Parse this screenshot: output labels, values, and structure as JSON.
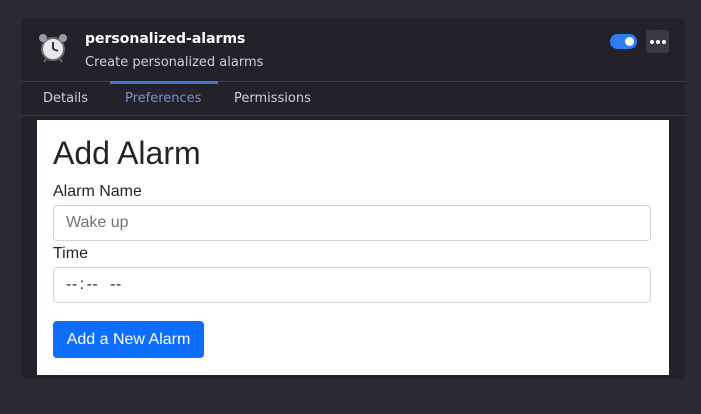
{
  "addon": {
    "name": "personalized-alarms",
    "description": "Create personalized alarms",
    "icon": "alarm-clock-icon",
    "enabled": true
  },
  "tabs": [
    {
      "label": "Details",
      "active": false
    },
    {
      "label": "Preferences",
      "active": true
    },
    {
      "label": "Permissions",
      "active": false
    }
  ],
  "form": {
    "title": "Add Alarm",
    "alarm_name_label": "Alarm Name",
    "alarm_name_placeholder": "Wake up",
    "time_label": "Time",
    "time_hours": "--",
    "time_minutes": "--",
    "time_period": "--",
    "submit_label": "Add a New Alarm"
  },
  "colors": {
    "accent": "#0d6efd",
    "toggle_on": "#2f7df6",
    "active_tab": "#7a8fcf"
  }
}
